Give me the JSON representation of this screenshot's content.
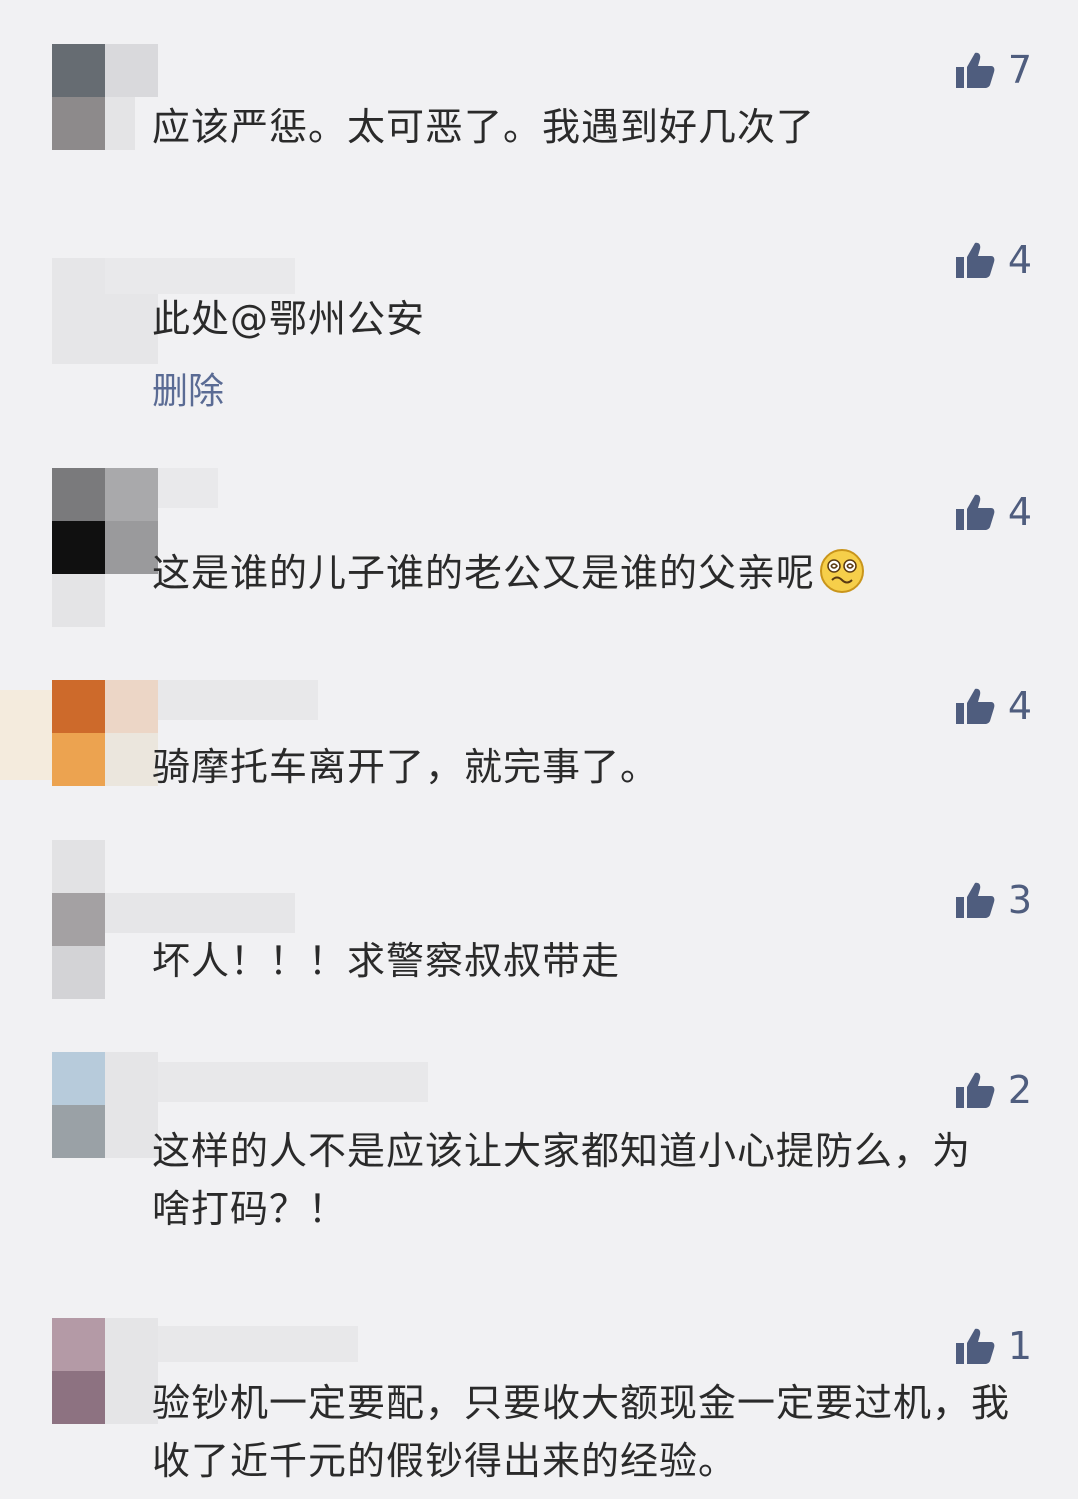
{
  "comments": [
    {
      "likes": "7",
      "text": "应该严惩。太可恶了。我遇到好几次了"
    },
    {
      "likes": "4",
      "text": "此处@鄂州公安",
      "action": "删除"
    },
    {
      "likes": "4",
      "text": "这是谁的儿子谁的老公又是谁的父亲呢",
      "emoji": "dizzy-face-emoji"
    },
    {
      "likes": "4",
      "text": "骑摩托车离开了，就完事了。"
    },
    {
      "likes": "3",
      "text": "坏人！！！求警察叔叔带走"
    },
    {
      "likes": "2",
      "text": "这样的人不是应该让大家都知道小心提防么，为啥打码？！"
    },
    {
      "likes": "1",
      "text": "验钞机一定要配，只要收大额现金一定要过机，我收了近千元的假钞得出来的经验。"
    }
  ],
  "icons": {
    "like": "thumbs-up-icon"
  },
  "colors": {
    "background": "#f1f1f3",
    "text": "#2a2a2a",
    "like": "#4f5d7e",
    "link": "#5a6b94"
  }
}
